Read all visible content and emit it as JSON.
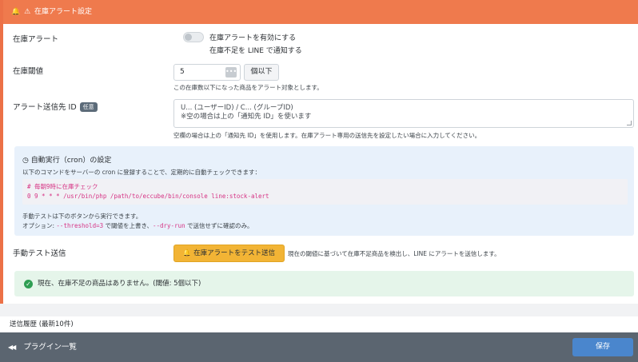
{
  "header": {
    "title": "在庫アラート設定",
    "bell": "🔔",
    "warn": "⚠"
  },
  "alert_enabled": {
    "label": "在庫アラート",
    "toggle_text": "在庫アラートを有効にする",
    "sub_text": "在庫不足を LINE で通知する",
    "on": false
  },
  "threshold": {
    "label": "在庫閾値",
    "value": "5",
    "dots": "•••",
    "suffix": "個以下",
    "help": "この在庫数以下になった商品をアラート対象とします。"
  },
  "recipient": {
    "label": "アラート送信先 ID",
    "badge": "任意",
    "placeholder_line1": "U... (ユーザーID) / C... (グループID)",
    "placeholder_line2": "※空の場合は上の「通知先 ID」を使います",
    "help": "空欄の場合は上の「通知先 ID」を使用します。在庫アラート専用の送信先を設定したい場合に入力してください。"
  },
  "cron": {
    "clock_icon": "◷",
    "title": "自動実行（cron）の設定",
    "desc": "以下のコマンドをサーバーの cron に登録することで、定期的に自動チェックできます：",
    "code_line1": "# 毎朝9時に在庫チェック",
    "code_line2": "0 9 * * * /usr/bin/php /path/to/eccube/bin/console line:stock-alert",
    "note1": "手動テストは下のボタンから実行できます。",
    "note2_pre": "オプション: ",
    "opt_threshold": "--threshold=3",
    "note2_mid": " で閾値を上書き、",
    "opt_dry_run": "--dry-run",
    "note2_post": " で送信せずに確認のみ。"
  },
  "manual_test": {
    "label": "手動テスト送信",
    "button": "在庫アラートをテスト送信",
    "bell": "🔔",
    "desc": "現在の閾値に基づいて在庫不足商品を検出し、LINE にアラートを送信します。"
  },
  "status": {
    "check": "✓",
    "message": "現在、在庫不足の商品はありません。(閾値: 5個以下)"
  },
  "history": {
    "title": "送信履歴 (最新10件)"
  },
  "footer": {
    "back_chev": "◀◀",
    "back_label": "プラグイン一覧",
    "save_label": "保存"
  }
}
